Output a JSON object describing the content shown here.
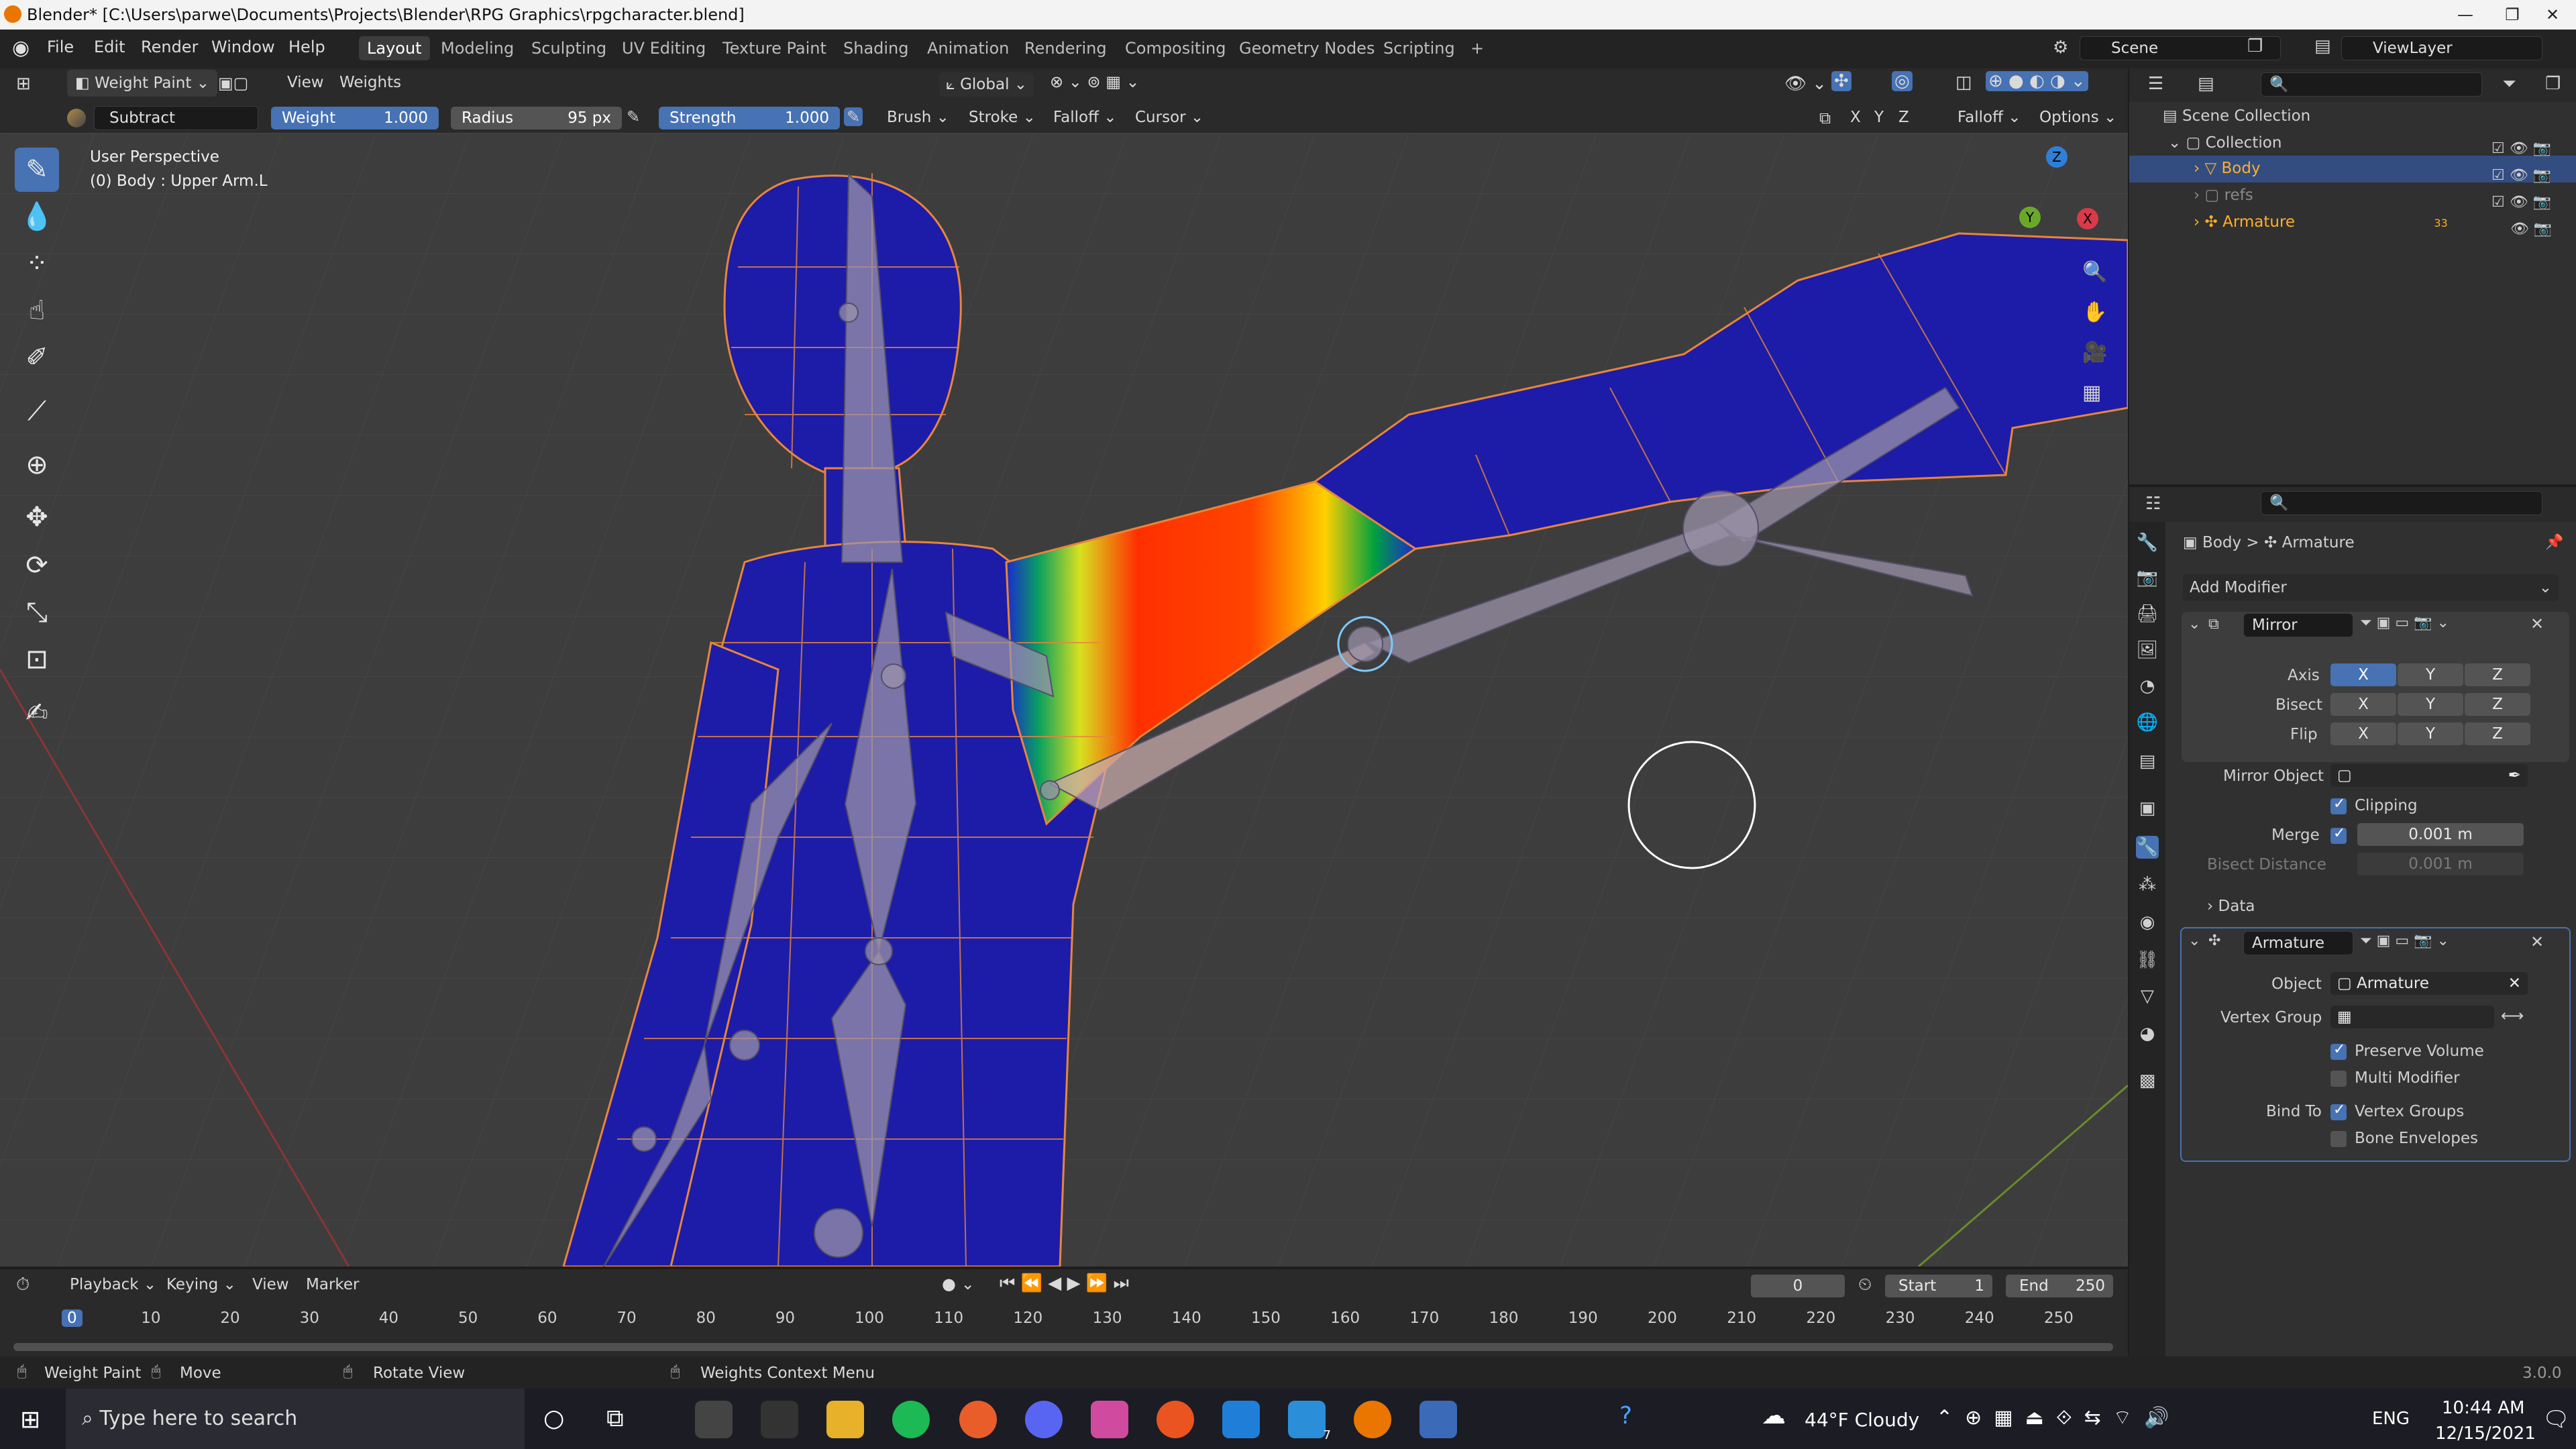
{
  "window": {
    "title": "Blender* [C:\\Users\\parwe\\Documents\\Projects\\Blender\\RPG Graphics\\rpgcharacter.blend]"
  },
  "menu": {
    "items": [
      "File",
      "Edit",
      "Render",
      "Window",
      "Help"
    ]
  },
  "workspaces": {
    "tabs": [
      "Layout",
      "Modeling",
      "Sculpting",
      "UV Editing",
      "Texture Paint",
      "Shading",
      "Animation",
      "Rendering",
      "Compositing",
      "Geometry Nodes",
      "Scripting"
    ],
    "add": "+"
  },
  "scene": {
    "label": "Scene",
    "viewlayer": "ViewLayer"
  },
  "header": {
    "mode": "Weight Paint",
    "view": "View",
    "weights": "Weights",
    "orientation": "Global",
    "falloff": "Falloff",
    "options": "Options",
    "axes": [
      "X",
      "Y",
      "Z"
    ]
  },
  "tool": {
    "brush_name": "Subtract",
    "weight_label": "Weight",
    "weight_value": "1.000",
    "radius_label": "Radius",
    "radius_value": "95 px",
    "strength_label": "Strength",
    "strength_value": "1.000",
    "brush": "Brush",
    "stroke": "Stroke",
    "falloff": "Falloff",
    "cursor": "Cursor"
  },
  "viewport": {
    "perspective": "User Perspective",
    "object": "(0) Body : Upper Arm.L",
    "gizmo_axes": [
      "Z",
      "Y",
      "X"
    ]
  },
  "outliner": {
    "root": "Scene Collection",
    "collection": "Collection",
    "items": [
      "Body",
      "refs",
      "Armature"
    ],
    "armature_badge": "33"
  },
  "properties": {
    "breadcrumb_obj": "Body",
    "breadcrumb_sep": ">",
    "breadcrumb_armature": "Armature",
    "add_modifier": "Add Modifier",
    "mirror": {
      "name": "Mirror",
      "axis_label": "Axis",
      "bisect_label": "Bisect",
      "flip_label": "Flip",
      "xyz": [
        "X",
        "Y",
        "Z"
      ],
      "mirror_object_label": "Mirror Object",
      "clipping": "Clipping",
      "merge_label": "Merge",
      "merge_value": "0.001 m",
      "bisect_distance_label": "Bisect Distance",
      "bisect_distance_value": "0.001 m",
      "data": "Data"
    },
    "armature": {
      "name": "Armature",
      "object_label": "Object",
      "object_value": "Armature",
      "vertex_group_label": "Vertex Group",
      "preserve_volume": "Preserve Volume",
      "multi_modifier": "Multi Modifier",
      "bind_to": "Bind To",
      "vertex_groups": "Vertex Groups",
      "bone_envelopes": "Bone Envelopes"
    }
  },
  "timeline": {
    "playback": "Playback",
    "keying": "Keying",
    "view": "View",
    "marker": "Marker",
    "current": "0",
    "start_label": "Start",
    "start": "1",
    "end_label": "End",
    "end": "250",
    "ruler": [
      "0",
      "10",
      "20",
      "30",
      "40",
      "50",
      "60",
      "70",
      "80",
      "90",
      "100",
      "110",
      "120",
      "130",
      "140",
      "150",
      "160",
      "170",
      "180",
      "190",
      "200",
      "210",
      "220",
      "230",
      "240",
      "250"
    ]
  },
  "status": {
    "left": "Weight Paint",
    "move": "Move",
    "rotate": "Rotate View",
    "context": "Weights Context Menu",
    "version": "3.0.0"
  },
  "taskbar": {
    "search_placeholder": "Type here to search",
    "weather": "44°F  Cloudy",
    "lang": "ENG",
    "time": "10:44 AM",
    "date": "12/15/2021",
    "blender_badge": "7"
  }
}
